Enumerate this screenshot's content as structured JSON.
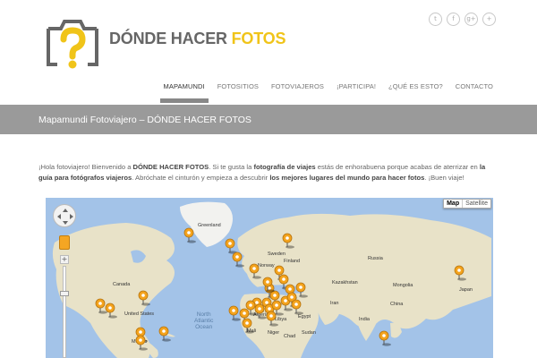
{
  "colors": {
    "brand_gray": "#666666",
    "brand_yellow": "#f0c419",
    "band": "#9a9a9a",
    "water": "#a3c3e8",
    "land": "#e8e2c8",
    "marker": "#f4a31c"
  },
  "logo": {
    "part1": "DÓNDE HACER ",
    "part2": "FOTOS",
    "icon": "camera-question-icon"
  },
  "social": [
    {
      "icon": "twitter-icon",
      "glyph": "t"
    },
    {
      "icon": "facebook-icon",
      "glyph": "f"
    },
    {
      "icon": "google-plus-icon",
      "glyph": "g+"
    },
    {
      "icon": "more-icon",
      "glyph": "+"
    }
  ],
  "nav": [
    {
      "label": "MAPAMUNDI",
      "active": true
    },
    {
      "label": "FOTOSITIOS",
      "active": false
    },
    {
      "label": "FOTOVIAJEROS",
      "active": false
    },
    {
      "label": "¡PARTICIPA!",
      "active": false
    },
    {
      "label": "¿QUÉ ES ESTO?",
      "active": false
    },
    {
      "label": "CONTACTO",
      "active": false
    }
  ],
  "page_title": "Mapamundi Fotoviajero – DÓNDE HACER FOTOS",
  "intro": {
    "t1": "¡Hola fotoviajero! Bienvenido a ",
    "b1": "DÓNDE HACER FOTOS",
    "t2": ". Si te gusta la ",
    "b2": "fotografía de viajes",
    "t3": " estás de enhorabuena porque acabas de aterrizar en ",
    "b3": "la guía para fotógrafos viajeros",
    "t4": ". Abróchate el cinturón y empieza a descubrir ",
    "b4": "los mejores lugares del mundo para hacer fotos",
    "t5": ". ¡Buen viaje!"
  },
  "map": {
    "type_map": "Map",
    "type_satellite": "Satellite",
    "zoom_plus": "+",
    "labels": {
      "greenland": "Greenland",
      "canada": "Canada",
      "united_states": "United States",
      "north_atlantic": "North\nAtlantic\nOcean",
      "sweden": "Sweden",
      "norway": "Norway",
      "finland": "Finland",
      "russia": "Russia",
      "kazakhstan": "Kazakhstan",
      "mongolia": "Mongolia",
      "china": "China",
      "algeria": "Algeria",
      "libya": "Libya",
      "egypt": "Egypt",
      "iran": "Iran",
      "india": "India",
      "mali": "Mali",
      "niger": "Niger",
      "chad": "Chad",
      "sudan": "Sudan",
      "japan": "Japan",
      "mexico": "Mexico"
    }
  }
}
